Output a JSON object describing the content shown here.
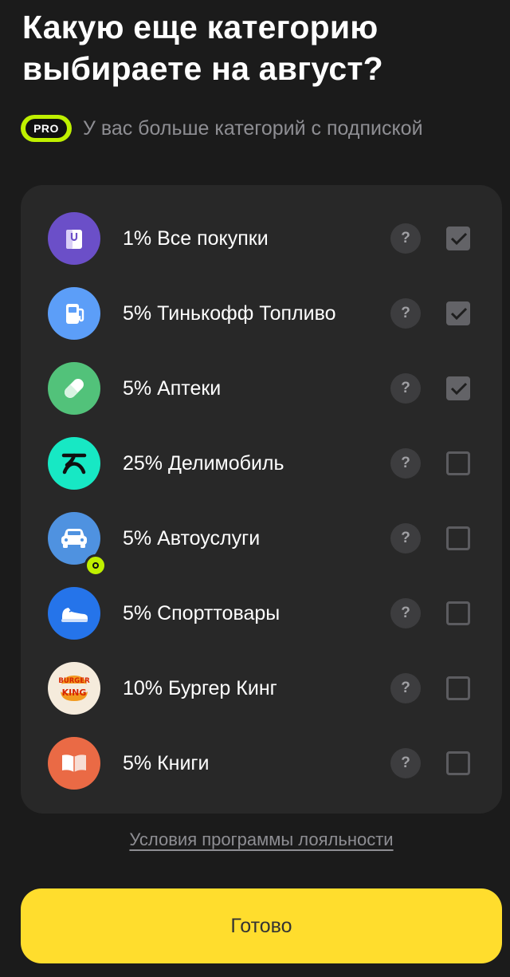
{
  "header": {
    "title_line1": "Какую еще категорию",
    "title_line2": "выбираете на август?"
  },
  "pro": {
    "badge": "PRO",
    "text": "У вас больше категорий с подпиской",
    "accent": "#bff000"
  },
  "categories": [
    {
      "label": "1% Все покупки",
      "icon": "shopping-bag-icon",
      "color": "#6b4fc8",
      "checked": true
    },
    {
      "label": "5% Тинькофф Топливо",
      "icon": "fuel-pump-icon",
      "color": "#5c9ef8",
      "checked": true
    },
    {
      "label": "5% Аптеки",
      "icon": "pill-icon",
      "color": "#52c27a",
      "checked": true
    },
    {
      "label": "25% Делимобиль",
      "icon": "delimobil-logo-icon",
      "color": "#17e8c4",
      "checked": false
    },
    {
      "label": "5% Автоуслуги",
      "icon": "car-icon",
      "color": "#4f92e0",
      "checked": false,
      "subscription_badge": true
    },
    {
      "label": "5% Спорттовары",
      "icon": "sneaker-icon",
      "color": "#2574ea",
      "checked": false
    },
    {
      "label": "10% Бургер Кинг",
      "icon": "burger-king-logo-icon",
      "color": "#f5ebdc",
      "checked": false
    },
    {
      "label": "5% Книги",
      "icon": "open-book-icon",
      "color": "#ea6a45",
      "checked": false
    }
  ],
  "help_label": "?",
  "footer": {
    "loyalty_link": "Условия программы лояльности",
    "done_button": "Готово",
    "button_color": "#ffdd2d"
  }
}
